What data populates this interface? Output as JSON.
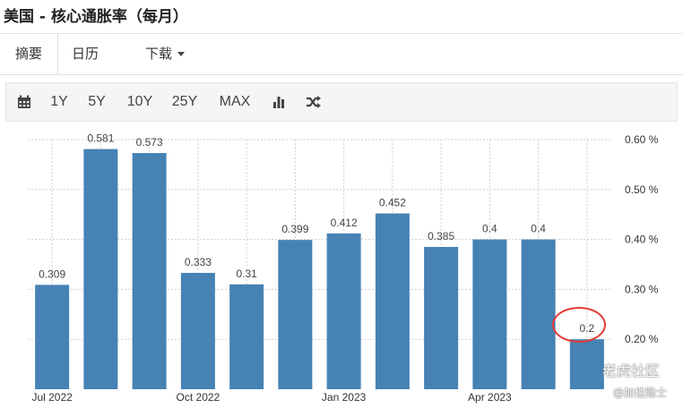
{
  "header": {
    "title": "美国 - 核心通胀率（每月）"
  },
  "tabs": [
    {
      "label": "摘要"
    },
    {
      "label": "日历"
    },
    {
      "label": "下载"
    }
  ],
  "toolbar": {
    "range_buttons": [
      "1Y",
      "5Y",
      "10Y",
      "25Y",
      "MAX"
    ],
    "icons": [
      "calendar-icon",
      "bar-chart-icon",
      "shuffle-icon"
    ]
  },
  "watermark": {
    "line1": "老虎社区",
    "line2": "@加位隐士"
  },
  "colors": {
    "bar": "#4682b4",
    "highlight_circle": "#e53935"
  },
  "chart_data": {
    "type": "bar",
    "categories": [
      "2022-07",
      "2022-08",
      "2022-09",
      "2022-10",
      "2022-11",
      "2022-12",
      "2023-01",
      "2023-02",
      "2023-03",
      "2023-04",
      "2023-05",
      "2023-06"
    ],
    "values": [
      0.309,
      0.581,
      0.573,
      0.333,
      0.31,
      0.399,
      0.412,
      0.452,
      0.385,
      0.4,
      0.4,
      0.2
    ],
    "data_labels": [
      "0.309",
      "0.581",
      "0.573",
      "0.333",
      "0.31",
      "0.399",
      "0.412",
      "0.452",
      "0.385",
      "0.4",
      "0.4",
      "0.2"
    ],
    "x_tick_labels": [
      {
        "category": "2022-07",
        "label": "Jul 2022"
      },
      {
        "category": "2022-10",
        "label": "Oct 2022"
      },
      {
        "category": "2023-01",
        "label": "Jan 2023"
      },
      {
        "category": "2023-04",
        "label": "Apr 2023"
      }
    ],
    "y_ticks": [
      0.2,
      0.3,
      0.4,
      0.5,
      0.6
    ],
    "y_tick_labels": [
      "0.20 %",
      "0.30 %",
      "0.40 %",
      "0.50 %",
      "0.60 %"
    ],
    "ylim": [
      0.1,
      0.6
    ],
    "grid": true,
    "y_axis_position": "right",
    "highlighted_category": "2023-06"
  }
}
